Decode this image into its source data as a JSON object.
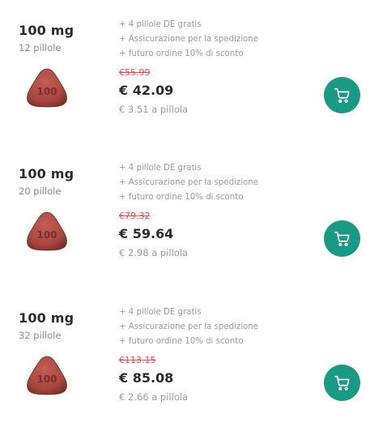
{
  "products": [
    {
      "dose": "100 mg",
      "count": "12 pillole",
      "pill_marking": "100",
      "perks": [
        "+ 4 pillole DE gratis",
        "+ Assicurazione per la spedizione",
        "+ futuro ordine 10% di sconto"
      ],
      "old_price": "€55.99",
      "price": "€ 42.09",
      "unit_price": "€ 3.51 a pillola"
    },
    {
      "dose": "100 mg",
      "count": "20 pillole",
      "pill_marking": "100",
      "perks": [
        "+ 4 pillole DE gratis",
        "+ Assicurazione per la spedizione",
        "+ futuro ordine 10% di sconto"
      ],
      "old_price": "€79.32",
      "price": "€ 59.64",
      "unit_price": "€ 2.98 a pillola"
    },
    {
      "dose": "100 mg",
      "count": "32 pillole",
      "pill_marking": "100",
      "perks": [
        "+ 4 pillole DE gratis",
        "+ Assicurazione per la spedizione",
        "+ futuro ordine 10% di sconto"
      ],
      "old_price": "€113.15",
      "price": "€ 85.08",
      "unit_price": "€ 2.66 a pillola"
    }
  ],
  "colors": {
    "accent": "#1a9a82",
    "old_price": "#e04a4a",
    "pill": "#a9473f"
  },
  "icons": {
    "cart": "cart-icon",
    "pill": "pill-image"
  }
}
